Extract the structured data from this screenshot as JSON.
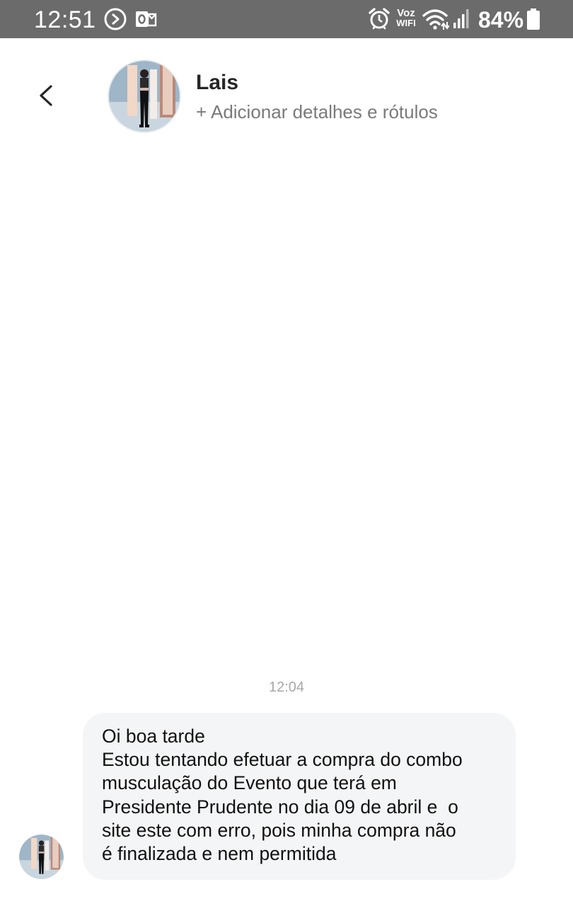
{
  "status_bar": {
    "time": "12:51",
    "network_label_top": "Voz",
    "network_label_bottom": "WIFI",
    "battery": "84%",
    "icons": [
      "sync-icon",
      "outlook-icon",
      "alarm-icon",
      "wifi-icon",
      "signal-icon",
      "battery-icon"
    ],
    "color": "#6b6b6b"
  },
  "header": {
    "contact_name": "Lais",
    "add_details": "+ Adicionar detalhes e rótulos",
    "back_icon": "chevron-left-icon"
  },
  "chat": {
    "timestamp": "12:04",
    "messages": [
      {
        "lines": [
          "Oi boa tarde",
          "Estou tentando efetuar a compra do combo",
          "musculação do Evento que terá em",
          "Presidente Prudente no dia 09 de abril e  o",
          "site este com erro, pois minha compra não",
          "é finalizada e nem permitida"
        ]
      }
    ],
    "bubble_color": "#f4f5f7"
  }
}
